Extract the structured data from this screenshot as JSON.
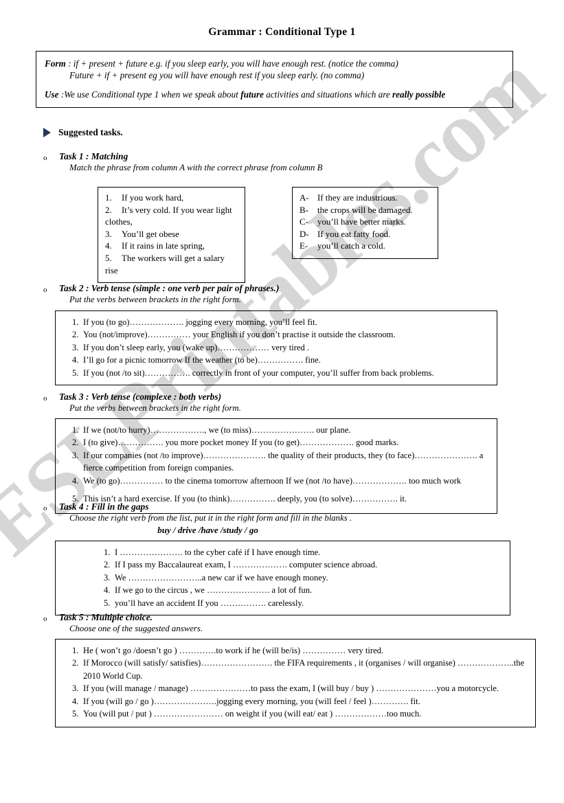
{
  "document": {
    "title": "Grammar : Conditional Type 1",
    "watermark": "ESLPrintables.com",
    "accent_color": "#1f3864"
  },
  "rule_box": {
    "form_label": "Form",
    "form_line1": " : if + present + future  e.g. if you sleep early, you will have enough rest. (notice the comma)",
    "form_line2": "Future +  if + present  eg you will have enough rest if you sleep early. (no comma)",
    "use_label": "Use",
    "use_line_part1": "   :We use Conditional type 1 when we speak about ",
    "use_bold1": "future",
    "use_line_part2": " activities and situations which are ",
    "use_bold2": "really  possible"
  },
  "suggested": {
    "bullet_icon": "triangle-right-icon",
    "label": "Suggested tasks."
  },
  "tasks": [
    {
      "marker": "o",
      "title": "Task 1 : Matching",
      "subtitle": "Match the phrase from column A with the correct phrase from column B"
    },
    {
      "marker": "o",
      "title": "Task 2 : Verb tense (simple : one verb per pair of phrases.)",
      "subtitle": "Put the verbs between brackets in the right form."
    },
    {
      "marker": "o",
      "title": "Task 3 : Verb tense (complexe : both verbs)",
      "subtitle": "Put the verbs between brackets in the right form."
    },
    {
      "marker": "o",
      "title": "Task 4 : Fill in the gaps",
      "subtitle": "Choose the right verb from the list, put it in the right form and fill in the blanks .",
      "wordbank": "buy / drive /have /study / go"
    },
    {
      "marker": "o",
      "title": "Task 5 : Multiple choice.",
      "subtitle": "Choose one of the suggested answers."
    }
  ],
  "task1": {
    "column_a": [
      {
        "num": "1.",
        "text": "If you work hard,"
      },
      {
        "num": "2.",
        "text": "It’s very cold.  If you wear light clothes,"
      },
      {
        "num": "3.",
        "text": "You’ll get obese"
      },
      {
        "num": "4.",
        "text": "If it rains in late spring,"
      },
      {
        "num": "5.",
        "text": "The workers will get a salary rise"
      }
    ],
    "column_b": [
      {
        "num": "A-",
        "text": "If  they are industrious."
      },
      {
        "num": "B-",
        "text": "the crops will be damaged."
      },
      {
        "num": "C-",
        "text": "you’ll have better marks."
      },
      {
        "num": "D-",
        "text": "If you eat fatty food."
      },
      {
        "num": "E-",
        "text": "you’ll catch a cold."
      }
    ]
  },
  "task2": {
    "items": [
      {
        "num": "1.",
        "text": "If you (to go)………………. jogging every morning, you’ll feel fit."
      },
      {
        "num": "2.",
        "text": "You (not/improve)…………… your English if you don’t practise it outside the classroom."
      },
      {
        "num": "3.",
        "text": "If you don’t sleep early, you  (wake up)……………… very tired ."
      },
      {
        "num": "4.",
        "text": "I’ll go for a picnic tomorrow If the weather (to be)……………. fine."
      },
      {
        "num": "5.",
        "text": "If you (not /to sit)……………. correctly in front of your computer, you’ll suffer from back problems."
      }
    ]
  },
  "task3": {
    "items": [
      {
        "num": "1.",
        "text": "If we (not/to hurry)………………., we (to miss)…………………. our plane."
      },
      {
        "num": "2.",
        "text": "I (to give)……………. you more pocket money If you (to get)………………. good marks."
      },
      {
        "num": "3.",
        "text": "If our companies (not /to improve)…………………. the quality of their products, they (to face)…………………. a fierce competition from foreign companies."
      },
      {
        "num": "4.",
        "text": "We (to go)…………… to the cinema tomorrow afternoon If we (not /to have)………………. too much work"
      },
      {
        "num": "5.",
        "text": "This isn’t a hard exercise. If you (to think)……………. deeply, you (to solve)……………. it."
      }
    ]
  },
  "task4": {
    "items": [
      {
        "num": "1.",
        "text": "I …………………. to the cyber café if I have enough time."
      },
      {
        "num": "2.",
        "text": "If I pass my Baccalaureat exam, I ………………. computer science abroad."
      },
      {
        "num": "3.",
        "text": "We ……………………..a new car if we have enough money."
      },
      {
        "num": "4.",
        "text": "If we go to the circus , we …………………. a lot of fun."
      },
      {
        "num": "5.",
        "text": "you’ll have an accident If you ……………. carelessly."
      }
    ]
  },
  "task5": {
    "items": [
      {
        "num": "1.",
        "text": "He ( won’t go /doesn’t go ) ………….to work if he (will be/is) …………… very tired."
      },
      {
        "num": "2.",
        "text": "If Morocco (will satisfy/ satisfies)……………………. the FIFA requirements , it (organises / will organise) ………………..the 2010 World Cup."
      },
      {
        "num": "3.",
        "text": "If  you (will manage / manage) …………………to pass the exam, I (will buy / buy ) …………………you a motorcycle."
      },
      {
        "num": "4.",
        "text": "If you (will go / go )………………….jogging every morning, you (will feel / feel )…………. fit."
      },
      {
        "num": "5.",
        "text": "You (will put / put ) …………………… on weight if you (will eat/ eat ) ………………too much."
      }
    ]
  }
}
